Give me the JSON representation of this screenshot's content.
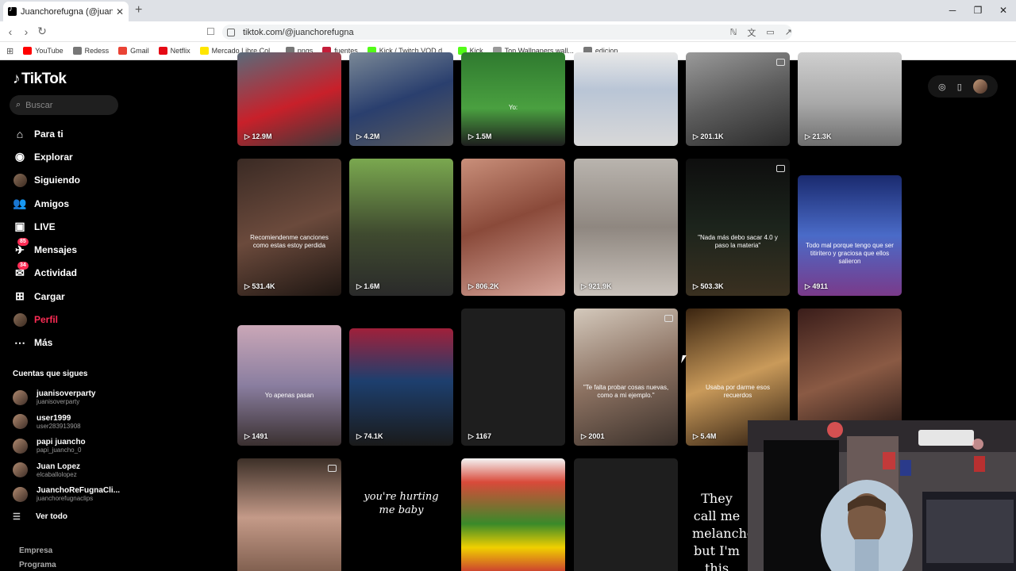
{
  "browser": {
    "tab_title": "Juanchorefugna (@juanchorefug...",
    "url": "tiktok.com/@juanchorefugna",
    "bookmarks": [
      {
        "label": "YouTube",
        "color": "#ff0000"
      },
      {
        "label": "Redess",
        "color": "#777777"
      },
      {
        "label": "Gmail",
        "color": "#ea4335"
      },
      {
        "label": "Netflix",
        "color": "#e50914"
      },
      {
        "label": "Mercado Libre Col...",
        "color": "#ffe600"
      },
      {
        "label": "pngs",
        "color": "#777777"
      },
      {
        "label": "fuentes",
        "color": "#c41e3a"
      },
      {
        "label": "Kick / Twitch VOD d...",
        "color": "#53fc18"
      },
      {
        "label": "Kick",
        "color": "#53fc18"
      },
      {
        "label": "Top Wallpapers wall...",
        "color": "#999999"
      },
      {
        "label": "edicion",
        "color": "#777777"
      }
    ]
  },
  "sidebar": {
    "logo": "TikTok",
    "search_placeholder": "Buscar",
    "menu": [
      {
        "label": "Para ti",
        "icon": "home-icon"
      },
      {
        "label": "Explorar",
        "icon": "compass-icon"
      },
      {
        "label": "Siguiendo",
        "icon": "following-icon"
      },
      {
        "label": "Amigos",
        "icon": "friends-icon"
      },
      {
        "label": "LIVE",
        "icon": "live-icon"
      },
      {
        "label": "Mensajes",
        "icon": "messages-icon",
        "badge": "85"
      },
      {
        "label": "Actividad",
        "icon": "activity-icon",
        "badge": "34"
      },
      {
        "label": "Cargar",
        "icon": "upload-icon"
      },
      {
        "label": "Perfil",
        "icon": "profile-icon",
        "active": true
      },
      {
        "label": "Más",
        "icon": "more-icon"
      }
    ],
    "following_title": "Cuentas que sigues",
    "following": [
      {
        "name": "juanisoverparty",
        "handle": "juanisoverparty"
      },
      {
        "name": "user1999",
        "handle": "user283913908"
      },
      {
        "name": "papi juancho",
        "handle": "papi_juancho_0"
      },
      {
        "name": "Juan Lopez",
        "handle": "elcaballolopez"
      },
      {
        "name": "JuanchoReFugnaCli...",
        "handle": "juanchorefugnaclips"
      }
    ],
    "see_all": "Ver todo",
    "footer": [
      "Empresa",
      "Programa"
    ]
  },
  "videos": [
    {
      "views": "12.9M",
      "bg": "linear-gradient(160deg,#5a6b7a,#c8202a 55%,#3a3a3a)",
      "caption": ""
    },
    {
      "views": "4.2M",
      "bg": "linear-gradient(160deg,#7a8896,#2a3f6e 50%,#5b5b5b)",
      "caption": ""
    },
    {
      "views": "1.5M",
      "bg": "linear-gradient(180deg,#2f7a2f,#4aa040 60%,#1e1e1e)",
      "caption": "Yo:"
    },
    {
      "views": "",
      "bg": "linear-gradient(180deg,#e8e8e8,#b9c5d6 40%,#d8d8d8)",
      "caption": ""
    },
    {
      "views": "201.1K",
      "bg": "linear-gradient(160deg,#9a9a9a,#5c5c5c 50%,#2b2b2b)",
      "caption": ""
    },
    {
      "views": "21.3K",
      "bg": "linear-gradient(180deg,#cfcfcf,#a8a8a8 55%,#6e6e6e)",
      "caption": ""
    },
    {
      "views": "531.4K",
      "bg": "linear-gradient(160deg,#3a2a24,#6b4a3c 50%,#1e1612)",
      "caption": "Recomiendenme canciones como estas estoy perdida"
    },
    {
      "views": "1.6M",
      "bg": "linear-gradient(180deg,#7aa84f,#3f4a2f 55%,#2a2a2a)",
      "caption": ""
    },
    {
      "views": "806.2K",
      "bg": "linear-gradient(160deg,#c98f7a,#8a4a3a 45%,#d7a59a)",
      "caption": ""
    },
    {
      "views": "921.9K",
      "bg": "linear-gradient(180deg,#b9b4ae,#8f8780 50%,#c9c2bb)",
      "caption": ""
    },
    {
      "views": "503.3K",
      "bg": "linear-gradient(180deg,#0e0e0e,#1c241c 50%,#3a3020)",
      "caption": "\"Nada más debo sacar 4.0 y paso la materia\""
    },
    {
      "views": "4911",
      "bg": "linear-gradient(180deg,#1a2a6e,#4a6bc8 50%,#7a3a8a)",
      "caption": "Todo mal porque tengo que ser titiritero y graciosa que ellos salieron"
    },
    {
      "views": "1491",
      "bg": "linear-gradient(180deg,#caa7b7,#8a7ea0 50%,#3a3030)",
      "caption": "Yo apenas pasan"
    },
    {
      "views": "74.1K",
      "bg": "linear-gradient(180deg,#a0203a,#1d3f6e 45%,#1a1a1a)",
      "caption": ""
    },
    {
      "views": "1167",
      "bg": "#1e1e1e",
      "caption": ""
    },
    {
      "views": "2001",
      "bg": "linear-gradient(160deg,#d4c9bc,#8a7060 50%,#3a302a)",
      "caption": "\"Te falta probar cosas nuevas, como a mi ejemplo.\""
    },
    {
      "views": "5.4M",
      "bg": "linear-gradient(160deg,#3a2410,#c99a5a 50%,#2a1a0e)",
      "caption": "Usaba por darme esos recuerdos"
    },
    {
      "views": "",
      "bg": "linear-gradient(160deg,#3a1d1a,#8a5a44 50%,#1a1010)",
      "caption": ""
    },
    {
      "views": "",
      "bg": "linear-gradient(180deg,#3d3028,#c49a88 50%,#7a5a4a)",
      "caption": ""
    },
    {
      "views": "",
      "bg": "#000000",
      "caption": "you're hurting me baby"
    },
    {
      "views": "",
      "bg": "linear-gradient(180deg,#f4f4f4,#d94a3a 20%,#3a8a2a 55%,#f0d000 75%,#c4203a)",
      "caption": ""
    },
    {
      "views": "",
      "bg": "#1e1e1e",
      "caption": ""
    },
    {
      "views": "",
      "bg": "#000000",
      "caption": "They call me melancholic, but I'm this way"
    }
  ],
  "colors": {
    "accent": "#fe2c55"
  }
}
